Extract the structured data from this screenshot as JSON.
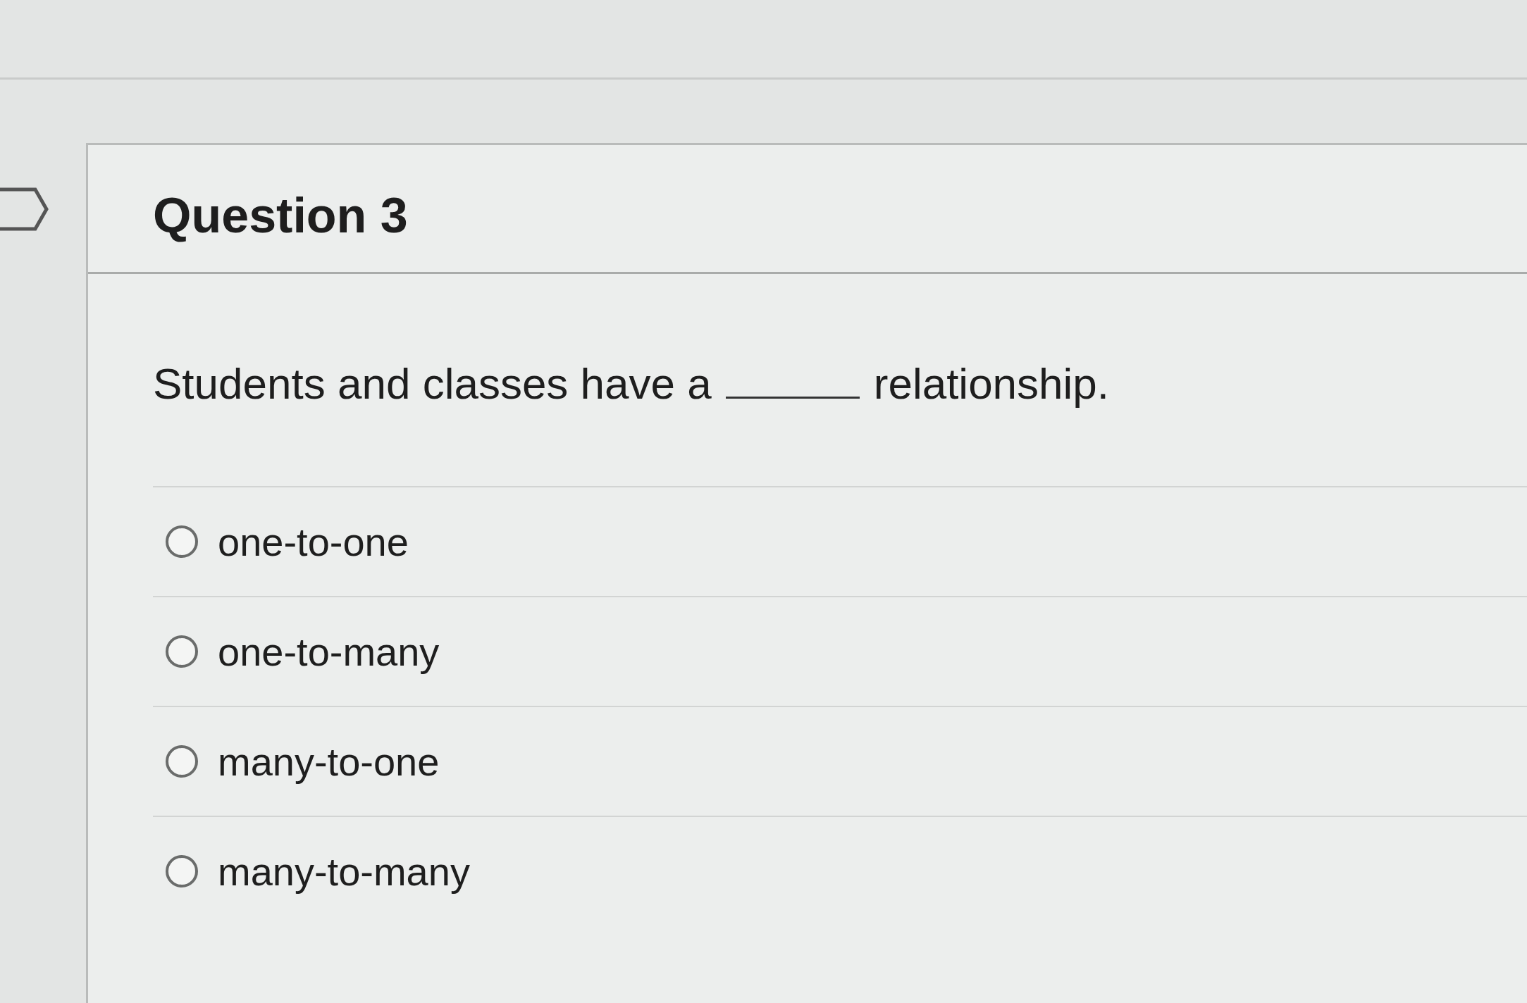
{
  "question": {
    "title": "Question 3",
    "text_before": "Students and classes have a",
    "text_after": "relationship.",
    "options": [
      {
        "label": "one-to-one",
        "selected": false
      },
      {
        "label": "one-to-many",
        "selected": false
      },
      {
        "label": "many-to-one",
        "selected": false
      },
      {
        "label": "many-to-many",
        "selected": false
      }
    ]
  }
}
